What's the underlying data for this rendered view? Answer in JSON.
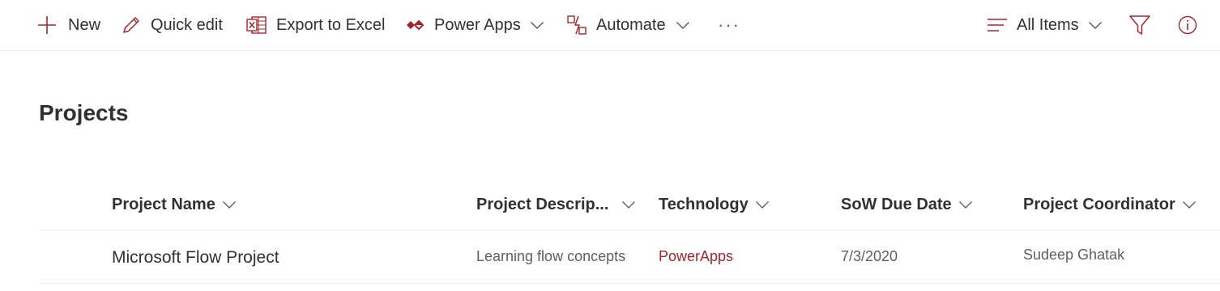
{
  "toolbar": {
    "new_label": "New",
    "quick_edit_label": "Quick edit",
    "export_label": "Export to Excel",
    "power_apps_label": "Power Apps",
    "automate_label": "Automate",
    "more_label": "···",
    "view_label": "All Items"
  },
  "page": {
    "title": "Projects"
  },
  "table": {
    "columns": [
      "Project Name",
      "Project Descrip...",
      "Technology",
      "SoW Due Date",
      "Project Coordinator"
    ],
    "rows": [
      {
        "name": "Microsoft Flow Project",
        "description": "Learning flow concepts",
        "technology": "PowerApps",
        "sow_due_date": "7/3/2020",
        "coordinator": "Sudeep Ghatak"
      }
    ]
  },
  "colors": {
    "accent": "#a4262c",
    "text": "#323130",
    "secondary_text": "#605e5c",
    "divider": "#edebe9"
  },
  "icons": [
    "plus-icon",
    "pencil-icon",
    "excel-icon",
    "power-apps-icon",
    "automate-icon",
    "list-view-icon",
    "filter-icon",
    "info-icon",
    "chevron-down-icon"
  ]
}
